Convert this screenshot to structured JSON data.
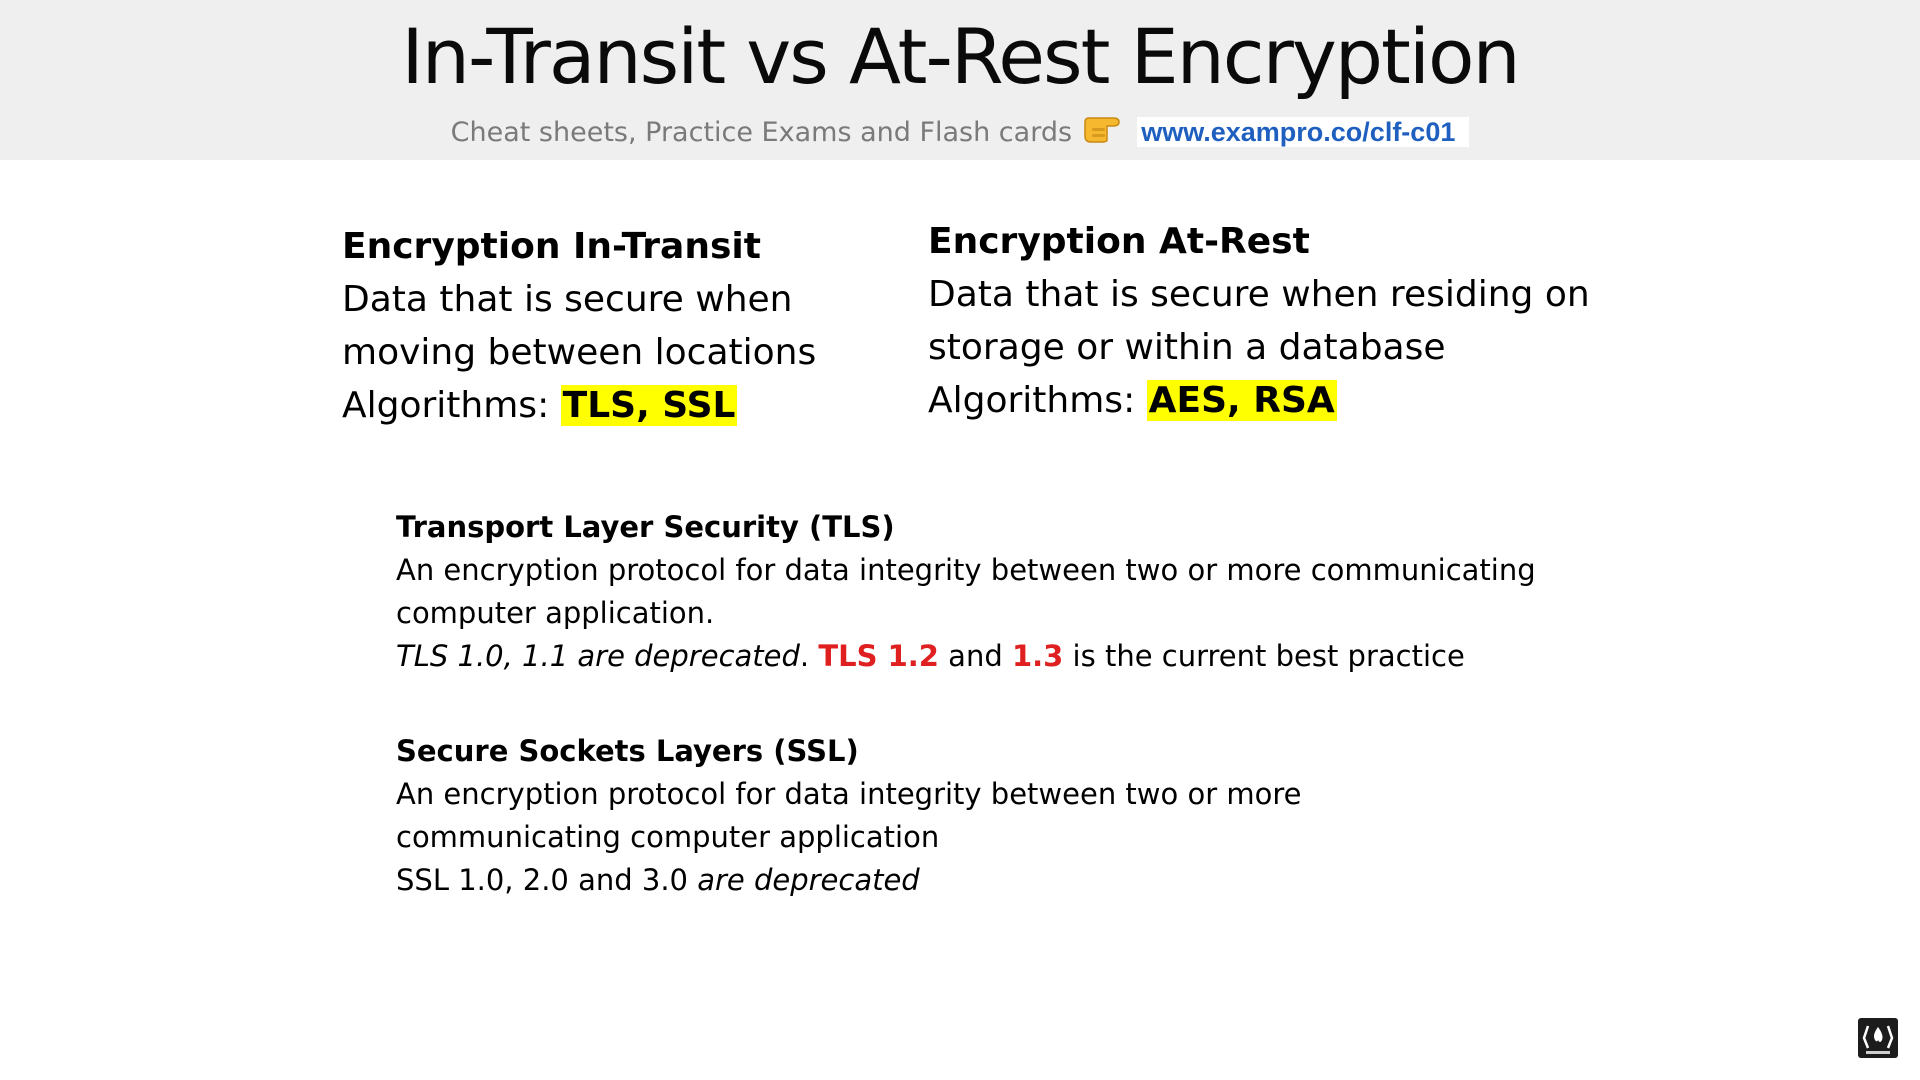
{
  "header": {
    "title": "In-Transit vs At-Rest Encryption",
    "subtitle_text": "Cheat sheets, Practice Exams and Flash cards",
    "subtitle_link": "www.exampro.co/clf-c01"
  },
  "columns": {
    "left": {
      "heading": "Encryption In-Transit",
      "line1": "Data that is secure when",
      "line2": "moving between locations",
      "algorithms_label": "Algorithms: ",
      "algorithms_value": "TLS, SSL"
    },
    "right": {
      "heading": "Encryption At-Rest",
      "line1": "Data that is secure when residing on",
      "line2": "storage or within a database",
      "algorithms_label": "Algorithms: ",
      "algorithms_value": "AES, RSA"
    }
  },
  "tls": {
    "heading": "Transport Layer Security (TLS)",
    "line1": "An encryption protocol for data integrity between two or more communicating",
    "line2": "computer application.",
    "line3_italic": "TLS 1.0, 1.1 are deprecated",
    "line3_dot": ". ",
    "line3_red1": "TLS 1.2",
    "line3_and": " and ",
    "line3_red2": "1.3",
    "line3_rest": " is the current best practice"
  },
  "ssl": {
    "heading": "Secure Sockets Layers (SSL)",
    "line1": "An encryption protocol for data integrity between two or more",
    "line2": "communicating computer application",
    "line3_plain": "SSL 1.0, 2.0 and 3.0 ",
    "line3_italic": "are deprecated"
  },
  "icons": {
    "pointer": "pointing-hand-icon",
    "subscribe": "subscribe-icon"
  },
  "colors": {
    "highlight": "#ffff00",
    "emphasis_red": "#e02020",
    "link_blue": "#1f5fbf",
    "header_bg": "#efefef"
  }
}
